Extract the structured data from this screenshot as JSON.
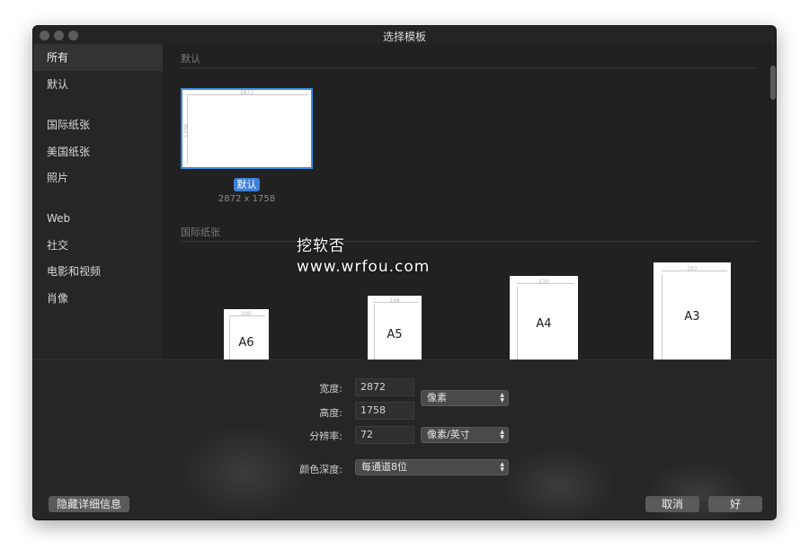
{
  "window": {
    "title": "选择模板"
  },
  "sidebar": {
    "items": [
      {
        "label": "所有"
      },
      {
        "label": "默认"
      },
      {
        "label": "国际纸张"
      },
      {
        "label": "美国纸张"
      },
      {
        "label": "照片"
      },
      {
        "label": "Web"
      },
      {
        "label": "社交"
      },
      {
        "label": "电影和视频"
      },
      {
        "label": "肖像"
      }
    ]
  },
  "main": {
    "default_section": {
      "title": "默认",
      "template": {
        "width_mark": "2872",
        "height_mark": "1758",
        "badge": "默认",
        "size": "2872 x 1758"
      }
    },
    "intl_section": {
      "title": "国际纸张",
      "papers": [
        {
          "name": "A6",
          "width_mark": "105",
          "height_mark": "148"
        },
        {
          "name": "A5",
          "width_mark": "148",
          "height_mark": "210"
        },
        {
          "name": "A4",
          "width_mark": "210",
          "height_mark": "297"
        },
        {
          "name": "A3",
          "width_mark": "297",
          "height_mark": "420"
        }
      ]
    }
  },
  "form": {
    "width": {
      "label": "宽度:",
      "value": "2872"
    },
    "height": {
      "label": "高度:",
      "value": "1758"
    },
    "size_unit": "像素",
    "resolution": {
      "label": "分辨率:",
      "value": "72",
      "unit": "像素/英寸"
    },
    "color_depth": {
      "label": "颜色深度:",
      "value": "每通道8位"
    }
  },
  "buttons": {
    "hide_details": "隐藏详细信息",
    "cancel": "取消",
    "ok": "好"
  },
  "watermark": {
    "line1": "挖软否",
    "line2": "www.wrfou.com"
  },
  "icons": {
    "stepper": "up-down-chevron-icon",
    "traffic": "window-control-dot-icon"
  }
}
